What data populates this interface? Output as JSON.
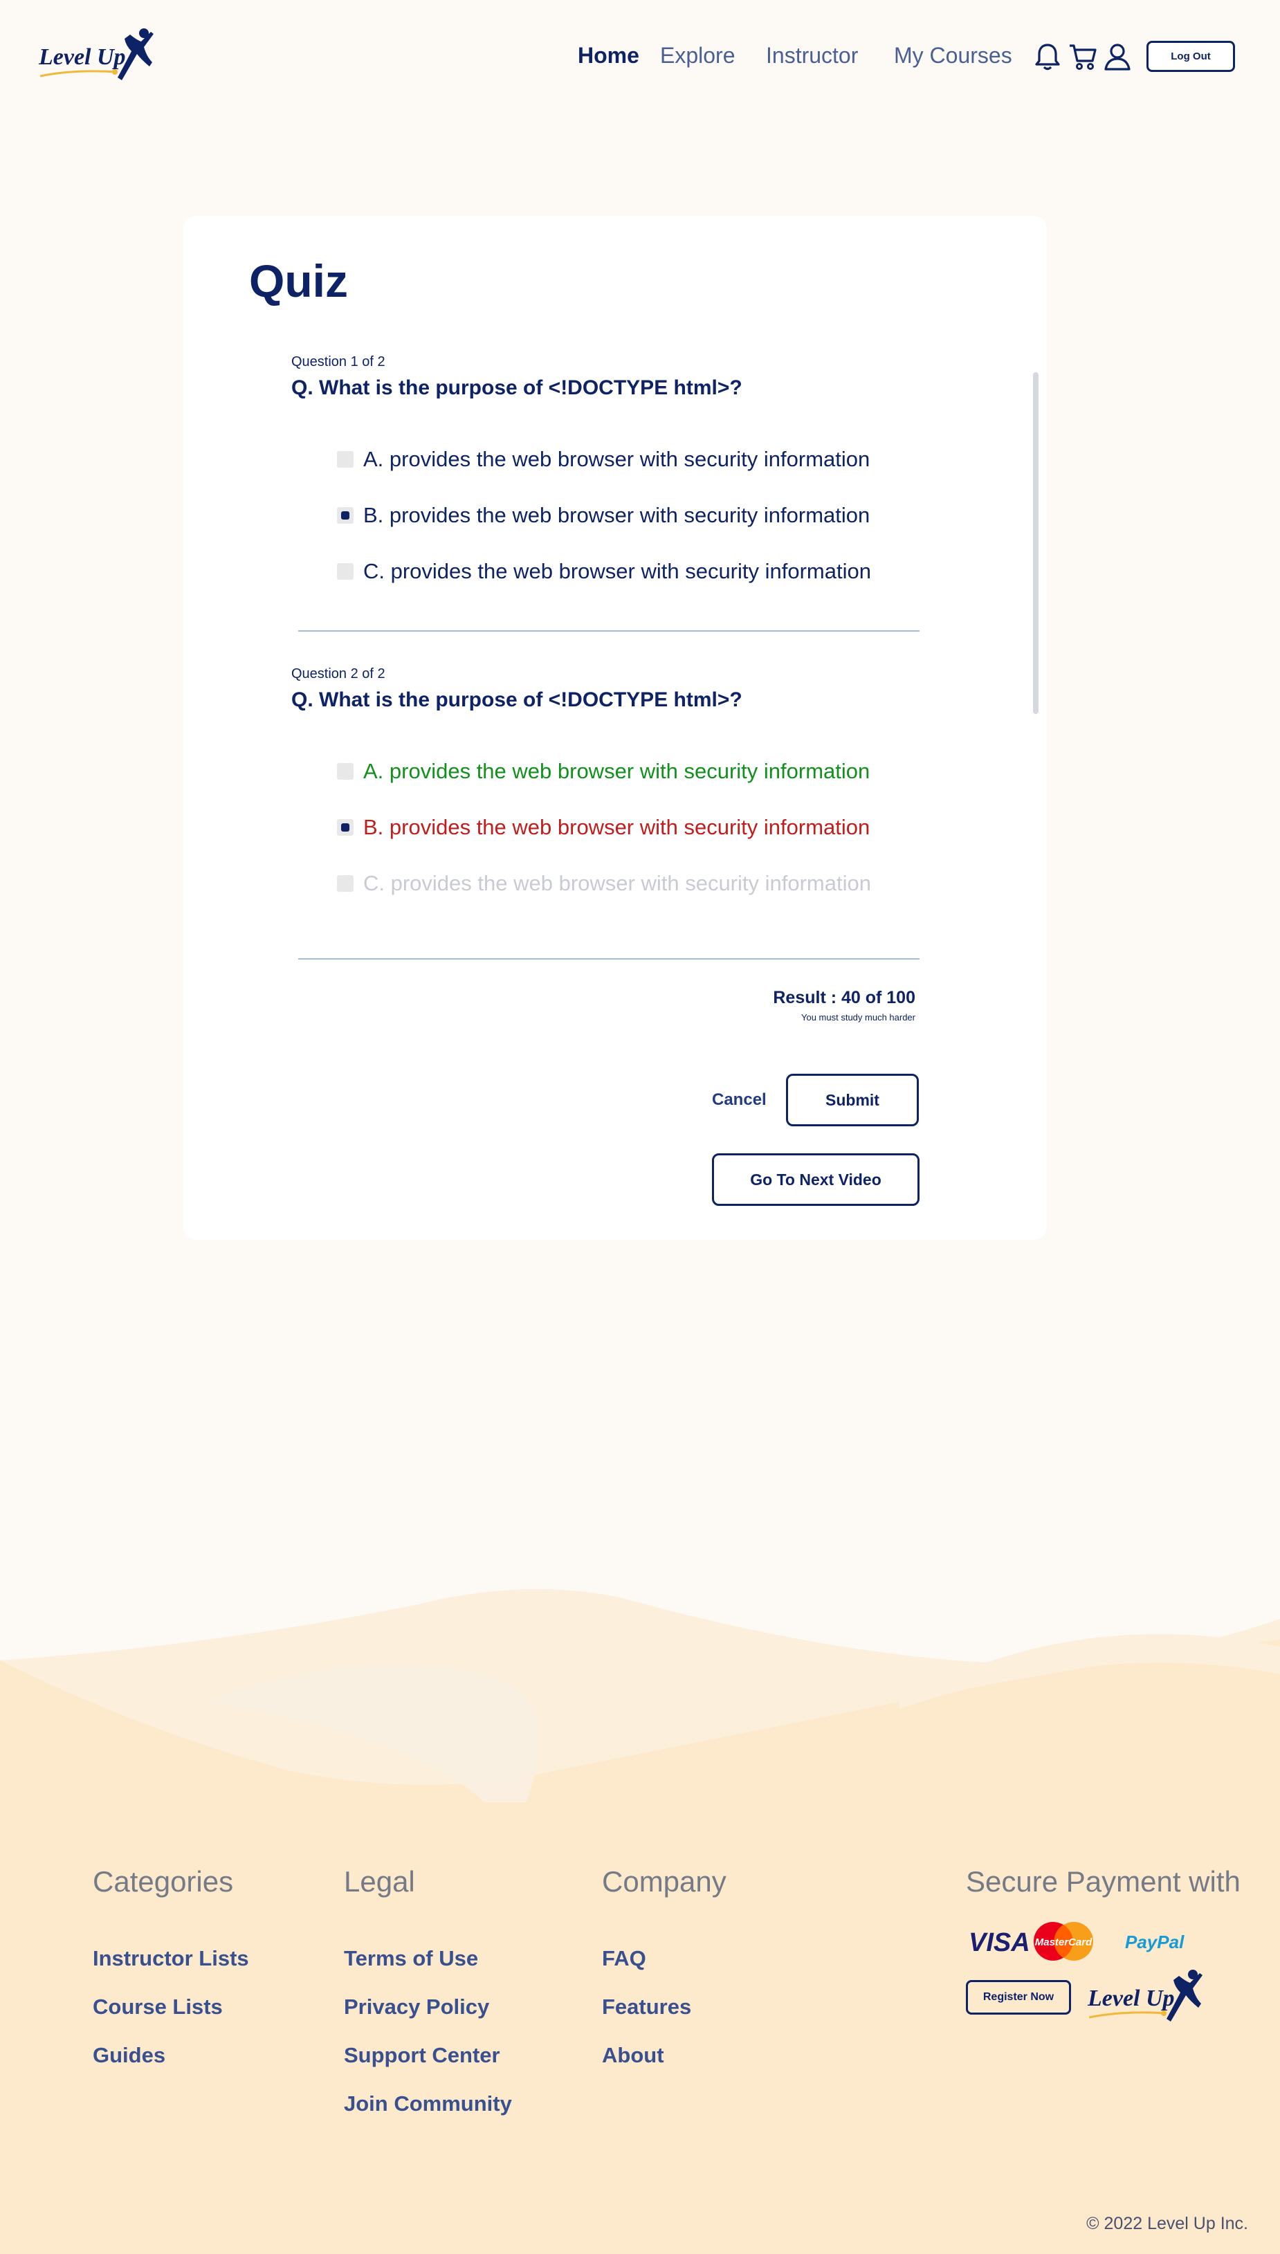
{
  "brand": {
    "name": "Level Up",
    "navy": "#0e2266",
    "gold": "#f0b93a"
  },
  "nav": {
    "items": [
      "Home",
      "Explore",
      "Instructor",
      "My Courses"
    ],
    "active": "Home",
    "icons": [
      "bell-icon",
      "cart-icon",
      "user-icon"
    ],
    "logout_label": "Log Out"
  },
  "quiz": {
    "title": "Quiz",
    "questions": [
      {
        "counter": "Question 1 of  2",
        "text": "Q. What is the purpose of <!DOCTYPE html>?",
        "options": [
          {
            "label": "A. provides the web browser with security information",
            "checked": false,
            "state": "default"
          },
          {
            "label": "B. provides the web browser with security information",
            "checked": true,
            "state": "default"
          },
          {
            "label": "C. provides the web browser with security information",
            "checked": false,
            "state": "default"
          }
        ]
      },
      {
        "counter": "Question 2 of  2",
        "text": "Q. What is the purpose of <!DOCTYPE html>?",
        "options": [
          {
            "label": "A. provides the web browser with security information",
            "checked": false,
            "state": "correct"
          },
          {
            "label": "B. provides the web browser with security information",
            "checked": true,
            "state": "wrong"
          },
          {
            "label": "C. provides the web browser with security information",
            "checked": false,
            "state": "faded"
          }
        ]
      }
    ],
    "result": {
      "label": "Result : 40 of 100",
      "message": "You must study much harder"
    },
    "cancel_label": "Cancel",
    "submit_label": "Submit",
    "next_label": "Go To Next Video",
    "colors": {
      "correct": "#11911c",
      "wrong": "#c21d1d",
      "faded": "#c9cbd3"
    }
  },
  "footer": {
    "categories": {
      "heading": "Categories",
      "links": [
        "Instructor Lists",
        "Course Lists",
        "Guides"
      ]
    },
    "legal": {
      "heading": "Legal",
      "links": [
        "Terms of Use",
        "Privacy Policy",
        "Support Center",
        "Join Community"
      ]
    },
    "company": {
      "heading": "Company",
      "links": [
        "FAQ",
        "Features",
        "About"
      ]
    },
    "payment": {
      "heading": "Secure Payment with",
      "visa": "VISA",
      "mastercard": "MasterCard",
      "paypal": "PayPal",
      "register_label": "Register Now"
    },
    "copyright": "© 2022 Level Up Inc."
  }
}
